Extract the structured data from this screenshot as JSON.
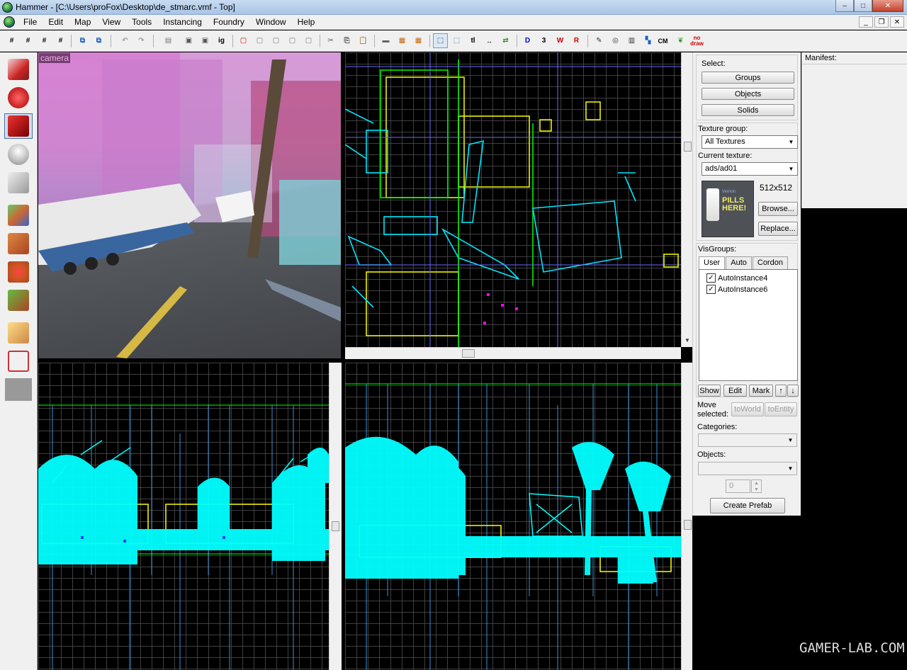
{
  "window": {
    "title": "Hammer - [C:\\Users\\proFox\\Desktop\\de_stmarc.vmf - Top]",
    "controls": {
      "minimize": "–",
      "maximize": "□",
      "close": "✕"
    }
  },
  "menu": {
    "items": [
      "File",
      "Edit",
      "Map",
      "View",
      "Tools",
      "Instancing",
      "Foundry",
      "Window",
      "Help"
    ],
    "mdi_controls": {
      "minimize": "_",
      "restore": "❐",
      "close": "✕"
    }
  },
  "toolbar": {
    "text_buttons": {
      "ig": "ig",
      "tl": "tl",
      "cm": "CM",
      "no_draw_top": "no",
      "no_draw_bottom": "draw"
    }
  },
  "viewports": {
    "camera_label": "camera"
  },
  "select_panel": {
    "label": "Select:",
    "buttons": [
      "Groups",
      "Objects",
      "Solids"
    ]
  },
  "texture_panel": {
    "group_label": "Texture group:",
    "group_value": "All Textures",
    "current_label": "Current texture:",
    "current_value": "ads/ad01",
    "size": "512x512",
    "browse": "Browse...",
    "replace": "Replace...",
    "preview_text_top": "Vernon",
    "preview_text_main": "PILLS HERE!"
  },
  "visgroups": {
    "label": "VisGroups:",
    "tabs": [
      "User",
      "Auto",
      "Cordon"
    ],
    "items": [
      {
        "name": "AutoInstance4",
        "checked": "✓"
      },
      {
        "name": "AutoInstance6",
        "checked": "✓"
      }
    ],
    "buttons": {
      "show": "Show",
      "edit": "Edit",
      "mark": "Mark",
      "up": "↑",
      "down": "↓"
    }
  },
  "move_panel": {
    "label_line1": "Move",
    "label_line2": "selected:",
    "to_world": "toWorld",
    "to_entity": "toEntity",
    "categories_label": "Categories:",
    "objects_label": "Objects:",
    "count_value": "0",
    "create_prefab": "Create Prefab"
  },
  "manifest": {
    "label": "Manifest:"
  },
  "watermark": "GAMER-LAB.COM"
}
